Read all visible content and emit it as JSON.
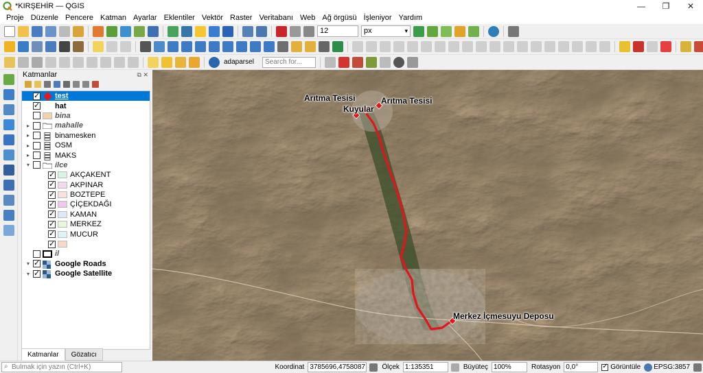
{
  "window": {
    "title": "*KIRŞEHİR — QGIS"
  },
  "menu": [
    "Proje",
    "Düzenle",
    "Pencere",
    "Katman",
    "Ayarlar",
    "Eklentiler",
    "Vektör",
    "Raster",
    "Veritabanı",
    "Web",
    "Ağ örgüsü",
    "İşleniyor",
    "Yardım"
  ],
  "toolbar": {
    "font_size": "12",
    "font_unit": "px",
    "search_layer": "adaparsel",
    "search_placeholder": "Search for..."
  },
  "layers": {
    "panel_title": "Katmanlar",
    "items": [
      {
        "name": "test",
        "checked": true,
        "symbol": "diamond",
        "style": "bold",
        "selected": true,
        "indent": 0
      },
      {
        "name": "hat",
        "checked": true,
        "symbol": "line",
        "style": "bold",
        "indent": 0
      },
      {
        "name": "bina",
        "checked": false,
        "symbol": "fill",
        "color": "#f6d2a8",
        "style": "italic",
        "indent": 0
      },
      {
        "name": "mahalle",
        "checked": false,
        "symbol": "group",
        "style": "italic",
        "expander": "▸",
        "indent": 0
      },
      {
        "name": "binamesken",
        "checked": false,
        "symbol": "stack",
        "style": "normal",
        "expander": "▸",
        "indent": 0
      },
      {
        "name": "OSM",
        "checked": false,
        "symbol": "stack",
        "style": "normal",
        "expander": "▸",
        "indent": 0
      },
      {
        "name": "MAKS",
        "checked": false,
        "symbol": "stack",
        "style": "normal",
        "expander": "▸",
        "indent": 0
      },
      {
        "name": "ilce",
        "checked": false,
        "symbol": "group",
        "style": "italic",
        "expander": "▾",
        "indent": 0
      },
      {
        "name": "AKÇAKENT",
        "checked": true,
        "symbol": "fill",
        "color": "#d7f5e3",
        "style": "normal",
        "indent": 1
      },
      {
        "name": "AKPINAR",
        "checked": true,
        "symbol": "fill",
        "color": "#f2d9f0",
        "style": "normal",
        "indent": 1
      },
      {
        "name": "BOZTEPE",
        "checked": true,
        "symbol": "fill",
        "color": "#fbe0e0",
        "style": "normal",
        "indent": 1
      },
      {
        "name": "ÇİÇEKDAĞI",
        "checked": true,
        "symbol": "fill",
        "color": "#f0c8ee",
        "style": "normal",
        "indent": 1
      },
      {
        "name": "KAMAN",
        "checked": true,
        "symbol": "fill",
        "color": "#dbe9fb",
        "style": "normal",
        "indent": 1
      },
      {
        "name": "MERKEZ",
        "checked": true,
        "symbol": "fill",
        "color": "#e8f7d8",
        "style": "normal",
        "indent": 1
      },
      {
        "name": "MUCUR",
        "checked": true,
        "symbol": "fill",
        "color": "#dff3f6",
        "style": "normal",
        "indent": 1
      },
      {
        "name": "",
        "checked": true,
        "symbol": "fill",
        "color": "#f8d8c8",
        "style": "normal",
        "indent": 1
      },
      {
        "name": "il",
        "checked": false,
        "symbol": "outline",
        "style": "italic",
        "indent": 0
      },
      {
        "name": "Google Roads",
        "checked": true,
        "symbol": "raster",
        "style": "bold",
        "expander": "▾",
        "indent": 0
      },
      {
        "name": "Google Satellite",
        "checked": true,
        "symbol": "raster",
        "style": "bold",
        "expander": "▾",
        "indent": 0
      }
    ],
    "tabs": [
      "Katmanlar",
      "Gözatıcı"
    ]
  },
  "map": {
    "labels": {
      "aritma1": "Arıtma Tesisi",
      "aritma2": "Arıtma Tesisi",
      "kuyular": "Kuyular",
      "depo": "Merkez İçmesuyu Deposu"
    },
    "route_color": "#e3141c"
  },
  "status": {
    "locator_placeholder": "Bulmak için yazın (Ctrl+K)",
    "coord_label": "Koordinat",
    "coord_value": "3785696,4758087",
    "scale_label": "Ölçek",
    "scale_value": "1:135351",
    "zoom_label": "Büyüteç",
    "zoom_value": "100%",
    "rotation_label": "Rotasyon",
    "rotation_value": "0,0°",
    "render_label": "Görüntüle",
    "crs": "EPSG:3857"
  }
}
